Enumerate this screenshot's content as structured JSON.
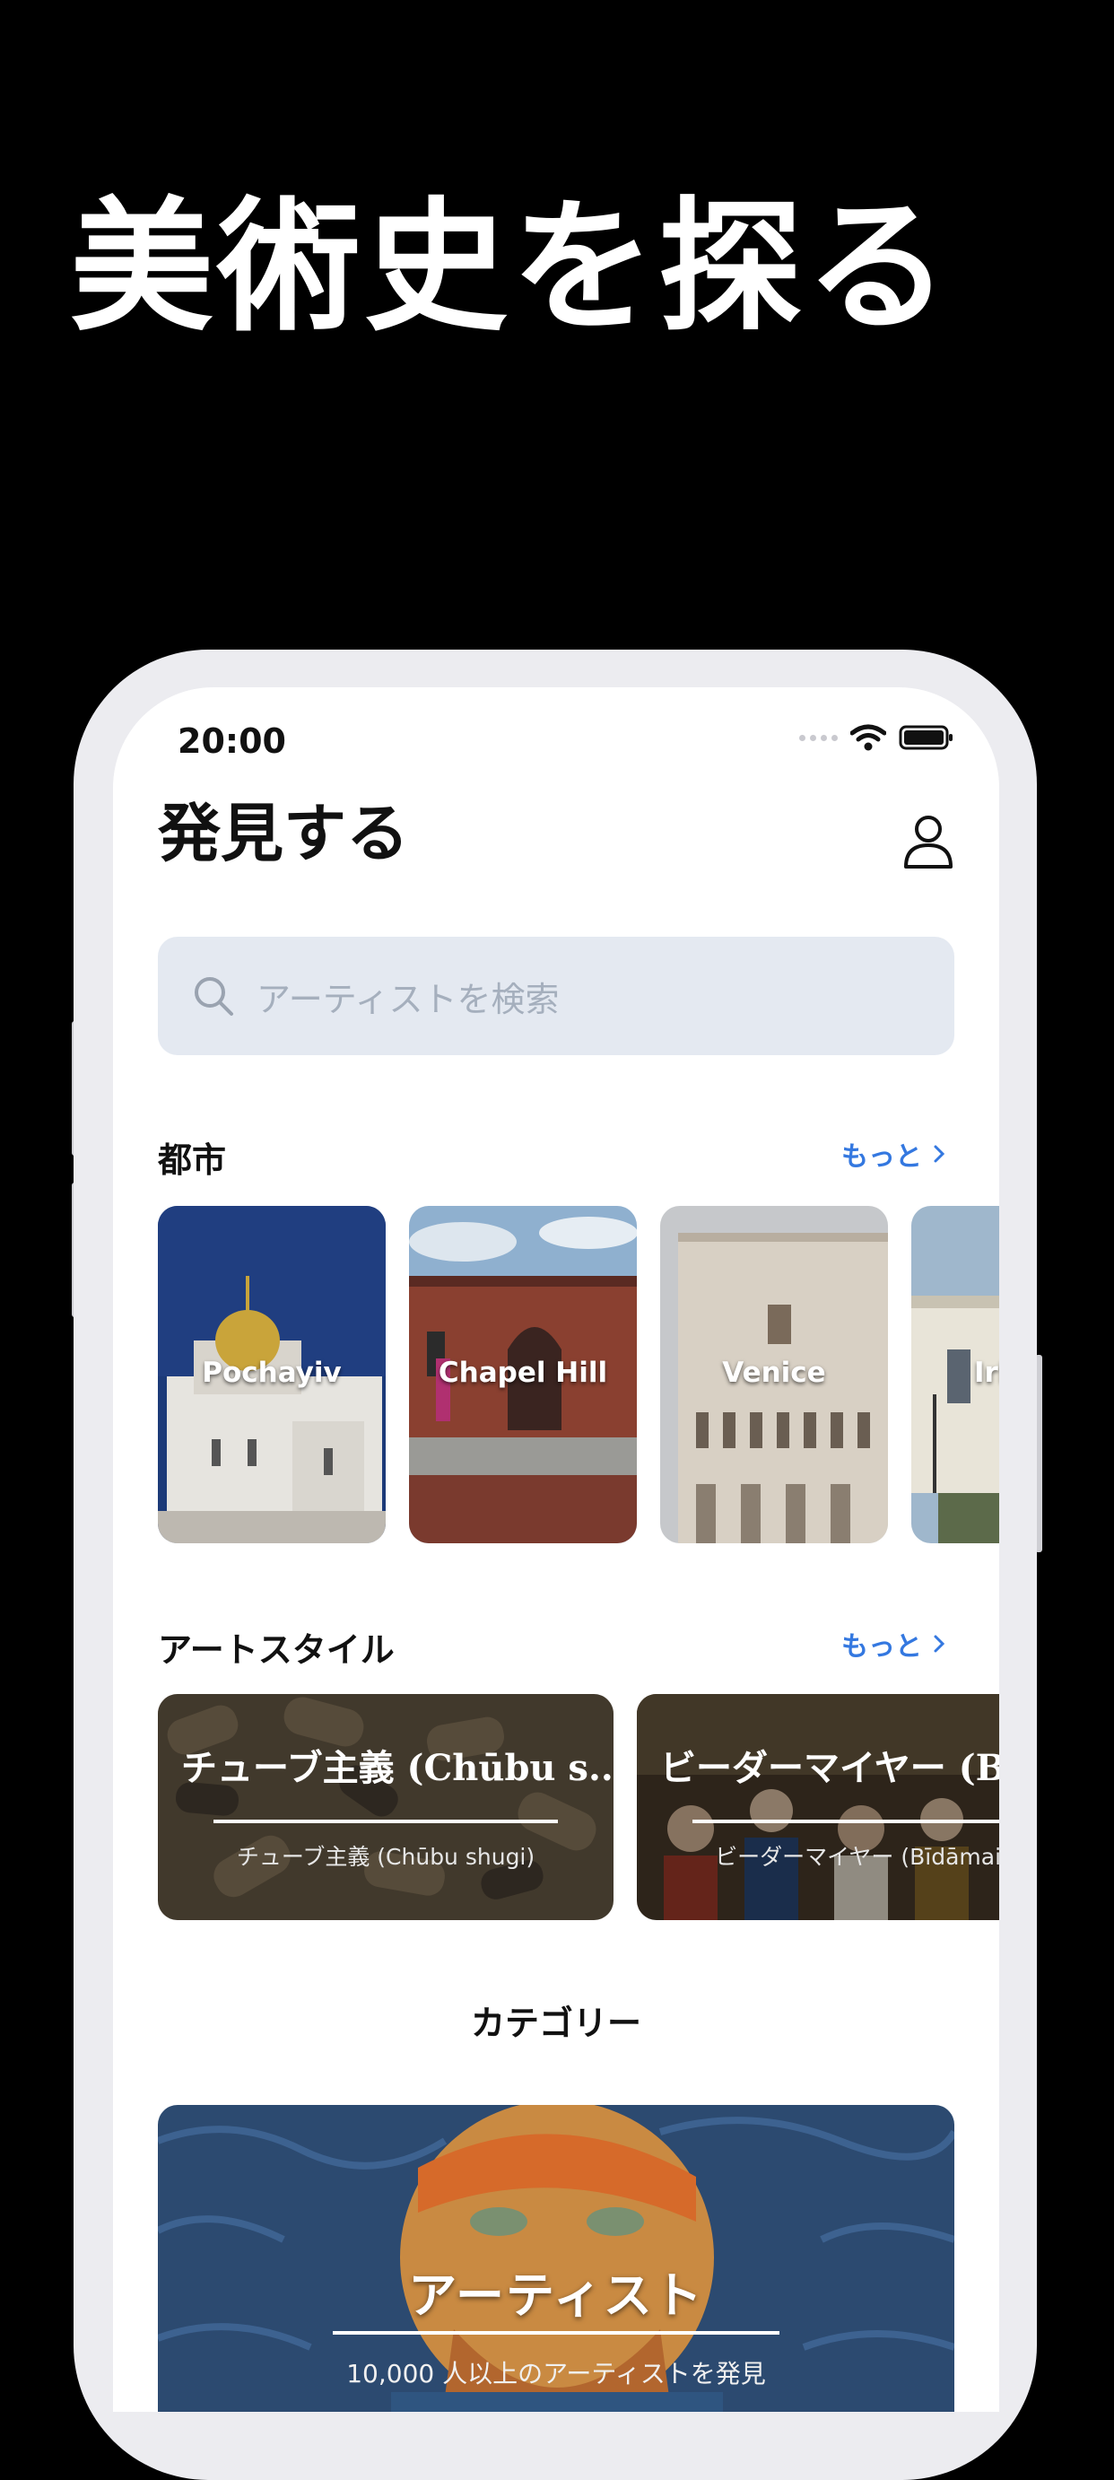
{
  "headline": "美術史を探る",
  "status": {
    "time": "20:00"
  },
  "header": {
    "title": "発見する"
  },
  "search": {
    "placeholder": "アーティストを検索"
  },
  "cities": {
    "title": "都市",
    "more": "もっと",
    "items": [
      {
        "label": "Pochayiv"
      },
      {
        "label": "Chapel Hill"
      },
      {
        "label": "Venice"
      },
      {
        "label": "Irk"
      }
    ]
  },
  "art_styles": {
    "title": "アートスタイル",
    "more": "もっと",
    "items": [
      {
        "title": "チューブ主義 (Chūbu s...",
        "subtitle": "チューブ主義 (Chūbu shugi)"
      },
      {
        "title": "ビーダーマイヤー (Bi",
        "subtitle": "ビーダーマイヤー (Bīdāmaiy"
      }
    ]
  },
  "categories": {
    "title": "カテゴリー",
    "card": {
      "title": "アーティスト",
      "subtitle": "10,000 人以上のアーティストを発見"
    }
  }
}
